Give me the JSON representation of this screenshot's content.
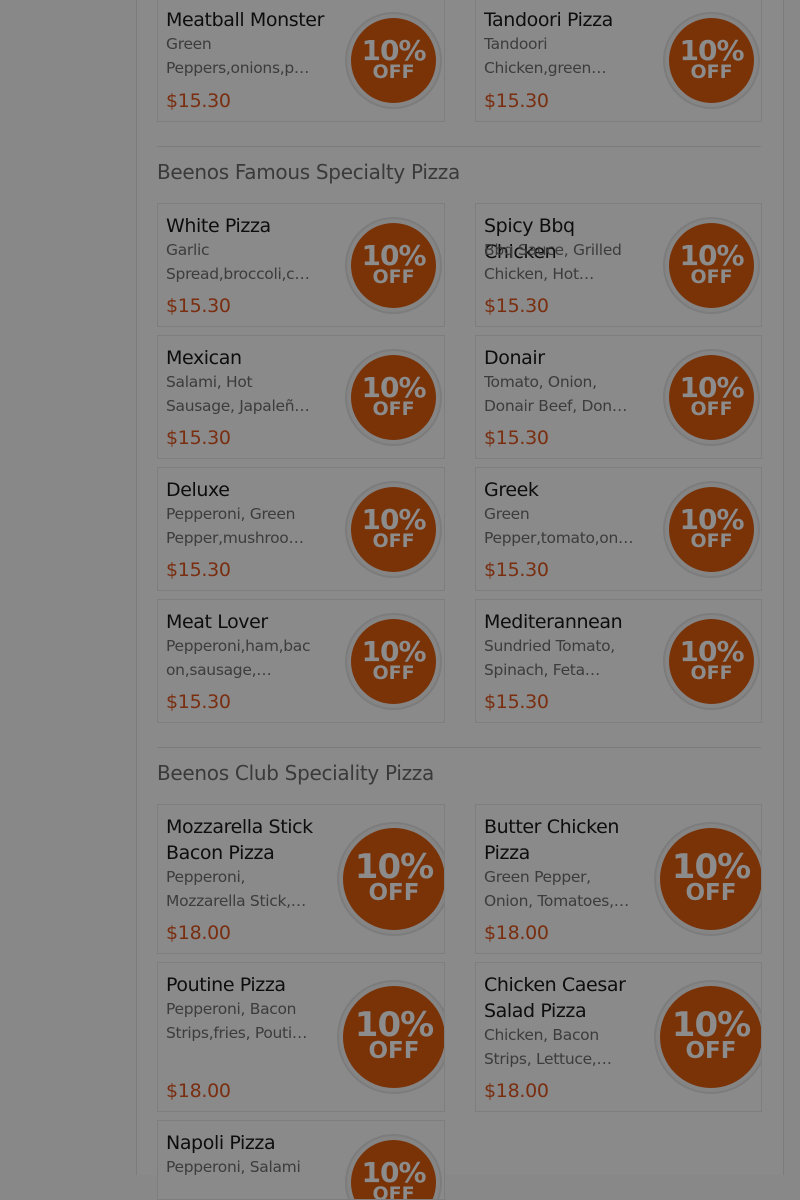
{
  "badge": {
    "percent": "10%",
    "off": "OFF"
  },
  "sections": [
    {
      "title": "",
      "items": [
        {
          "name": "Meatball Monster",
          "desc": "Green Peppers,onions,parmesan",
          "price": "$15.30"
        },
        {
          "name": "Tandoori Pizza",
          "desc": "Tandoori Chicken,green peppers",
          "price": "$15.30"
        }
      ]
    },
    {
      "title": "Beenos Famous Specialty Pizza",
      "items": [
        {
          "name": "White Pizza",
          "desc": "Garlic Spread,broccoli,chicken",
          "price": "$15.30"
        },
        {
          "name": "Spicy Bbq Chicken",
          "desc": "Bbq Sauce, Grilled Chicken, Hot Peppers",
          "price": "$15.30"
        },
        {
          "name": "Mexican",
          "desc": "Salami, Hot Sausage, Japaleño, Fresh Tomatoes",
          "price": "$15.30"
        },
        {
          "name": "Donair",
          "desc": "Tomato, Onion, Donair Beef, Donair Sauce",
          "price": "$15.30"
        },
        {
          "name": "Deluxe",
          "desc": "Pepperoni, Green Pepper,mushroom, onion",
          "price": "$15.30"
        },
        {
          "name": "Greek",
          "desc": "Green Pepper,tomato,onion, olives",
          "price": "$15.30"
        },
        {
          "name": "Meat Lover",
          "desc": "Pepperoni,ham,bacon,sausage, Ground Beef",
          "price": "$15.30"
        },
        {
          "name": "Mediterannean",
          "desc": "Sundried Tomato, Spinach, Feta Cheese",
          "price": "$15.30"
        }
      ]
    },
    {
      "title": "Beenos Club Speciality Pizza",
      "items": [
        {
          "name": "Mozzarella Stick Bacon Pizza",
          "desc": "Pepperoni, Mozzarella Stick, Bacon",
          "price": "$18.00"
        },
        {
          "name": "Butter Chicken Pizza",
          "desc": "Green Pepper, Onion, Tomatoes, Butter Chicken",
          "price": "$18.00"
        },
        {
          "name": "Poutine Pizza",
          "desc": "Pepperoni, Bacon Strips,fries, Poutine Gravy",
          "price": "$18.00"
        },
        {
          "name": "Chicken Caesar Salad Pizza",
          "desc": "Chicken, Bacon Strips, Lettuce, Caesar",
          "price": "$18.00"
        },
        {
          "name": "Napoli Pizza",
          "desc": "Pepperoni, Salami",
          "price": ""
        }
      ]
    }
  ]
}
